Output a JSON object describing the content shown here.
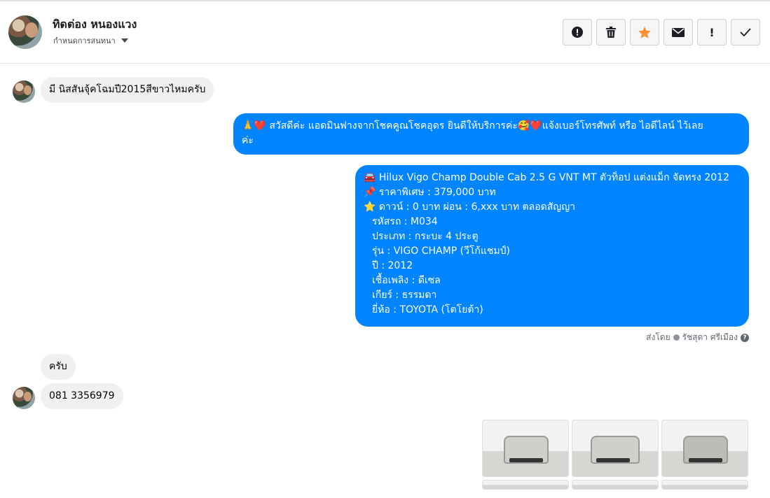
{
  "header": {
    "name": "ทิดต่อง หนองแวง",
    "assign_label": "กำหนดการสนทนา",
    "actions": [
      {
        "icon": "alert-circle-icon",
        "glyph": "!"
      },
      {
        "icon": "trash-icon",
        "glyph": ""
      },
      {
        "icon": "star-icon",
        "glyph": ""
      },
      {
        "icon": "envelope-icon",
        "glyph": ""
      },
      {
        "icon": "exclamation-icon",
        "glyph": "!"
      },
      {
        "icon": "checkmark-icon",
        "glyph": ""
      }
    ]
  },
  "messages": {
    "m1": "มี นิสสันจุ้คโฉมปี2015สีขาวไหมครับ",
    "m2_line1": "🙏❤️ สวัสดีค่ะ แอดมินฟางจากโชคคูณโชคอุดร ยินดีให้บริการค่ะ🥰❤️แจ้งเบอร์โทรศัพท์ หรือ ไอดีไลน์  ไว้เลย",
    "m2_line2": "ค่ะ",
    "m3": [
      "🚘 Hilux Vigo Champ Double Cab 2.5 G VNT MT ตัวท็อป แต่งแม็ก จัดทรง 2012",
      "📌 ราคาพิเศษ : 379,000 บาท",
      "⭐ ดาวน์ : 0 บาท ผ่อน : 6,xxx บาท ตลอดสัญญา",
      "รหัสรถ : M034",
      "ประเภท : กระบะ 4 ประตู",
      "รุ่น : VIGO CHAMP (วีโก้แชมป์)",
      "ปี : 2012",
      "เชื้อเพลิง : ดีเซล",
      "เกียร์ : ธรรมดา",
      "ยี่ห้อ : TOYOTA (โตโยต้า)"
    ],
    "sent_by_label": "ส่งโดย",
    "sent_by_name": "รัชสุดา ศรีเมือง",
    "m4": "ครับ",
    "m5": "081 3356979"
  },
  "colors": {
    "outgoing": "#0084ff",
    "incoming": "#f0f0f0",
    "star": "#f7923a"
  }
}
